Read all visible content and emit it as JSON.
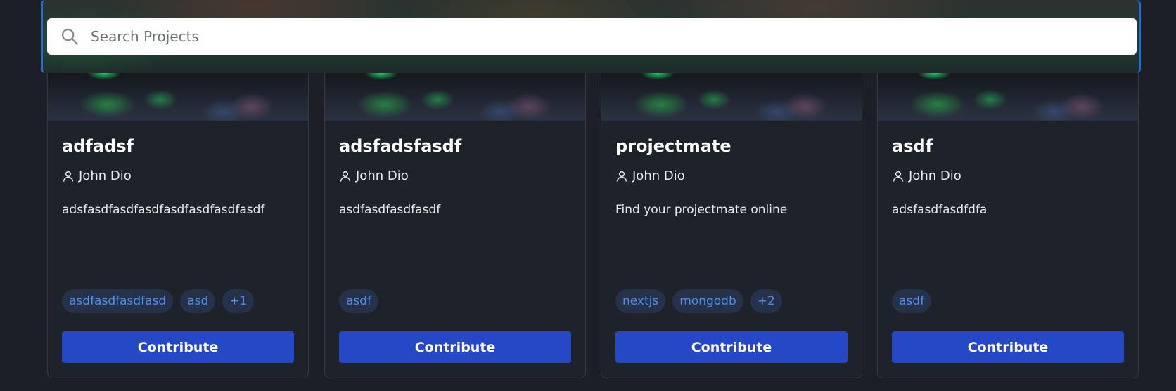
{
  "search": {
    "placeholder": "Search Projects"
  },
  "cards": [
    {
      "title": "adfadsf",
      "author": "John Dio",
      "description": "adsfasdfasdfasdfasdfasdfasdfasdf",
      "tags": [
        "asdfasdfasdfasd",
        "asd",
        "+1"
      ],
      "button_label": "Contribute"
    },
    {
      "title": "adsfadsfasdf",
      "author": "John Dio",
      "description": "asdfasdfasdfasdf",
      "tags": [
        "asdf"
      ],
      "button_label": "Contribute"
    },
    {
      "title": "projectmate",
      "author": "John Dio",
      "description": "Find your projectmate online",
      "tags": [
        "nextjs",
        "mongodb",
        "+2"
      ],
      "button_label": "Contribute"
    },
    {
      "title": "asdf",
      "author": "John Dio",
      "description": "adsfasdfasdfdfa",
      "tags": [
        "asdf"
      ],
      "button_label": "Contribute"
    }
  ],
  "colors": {
    "background": "#1c1f26",
    "card": "#1e222a",
    "button": "#2548c7",
    "tag_text": "#4d8ef0",
    "tag_bg": "#25324a",
    "accent_border": "#1f6fd4"
  }
}
